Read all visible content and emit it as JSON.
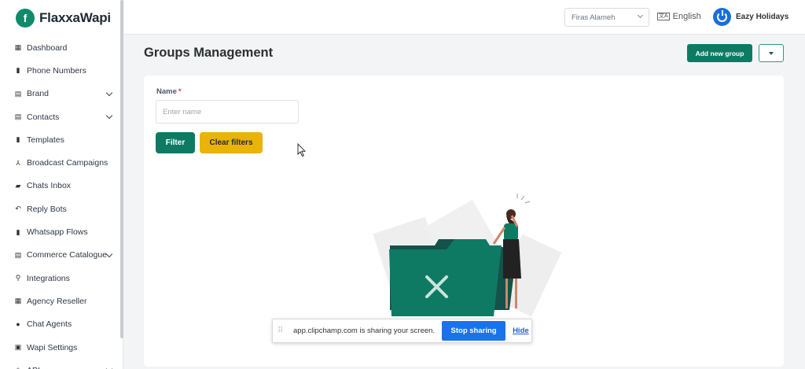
{
  "app": {
    "name": "FlaxxaWapi",
    "logo_letter": "f"
  },
  "sidebar": {
    "items": [
      {
        "label": "Dashboard",
        "icon": "dashboard-icon",
        "has_chevron": false
      },
      {
        "label": "Phone Numbers",
        "icon": "phone-numbers-icon",
        "has_chevron": false
      },
      {
        "label": "Brand",
        "icon": "brand-icon",
        "has_chevron": true
      },
      {
        "label": "Contacts",
        "icon": "contacts-icon",
        "has_chevron": true
      },
      {
        "label": "Templates",
        "icon": "templates-icon",
        "has_chevron": false
      },
      {
        "label": "Broadcast Campaigns",
        "icon": "broadcast-icon",
        "has_chevron": false
      },
      {
        "label": "Chats Inbox",
        "icon": "chats-icon",
        "has_chevron": false
      },
      {
        "label": "Reply Bots",
        "icon": "reply-icon",
        "has_chevron": false
      },
      {
        "label": "Whatsapp Flows",
        "icon": "flows-icon",
        "has_chevron": false
      },
      {
        "label": "Commerce Catalogue",
        "icon": "catalogue-icon",
        "has_chevron": true
      },
      {
        "label": "Integrations",
        "icon": "integrations-icon",
        "has_chevron": false
      },
      {
        "label": "Agency Reseller",
        "icon": "reseller-icon",
        "has_chevron": false
      },
      {
        "label": "Chat Agents",
        "icon": "agent-icon",
        "has_chevron": false
      },
      {
        "label": "Wapi Settings",
        "icon": "settings-icon",
        "has_chevron": false
      },
      {
        "label": "API",
        "icon": "api-icon",
        "has_chevron": true
      }
    ]
  },
  "topbar": {
    "user_select": "Firas Alameh",
    "language": "English",
    "company": "Eazy Holidays"
  },
  "main": {
    "title": "Groups Management",
    "add_button": "Add new group"
  },
  "filters": {
    "name_label": "Name",
    "required_mark": "*",
    "name_placeholder": "Enter name",
    "name_value": "",
    "filter_button": "Filter",
    "clear_button": "Clear filters"
  },
  "share_banner": {
    "message": "app.clipchamp.com is sharing your screen.",
    "stop_button": "Stop sharing",
    "hide_link": "Hide"
  },
  "colors": {
    "primary": "#0f7a64",
    "warning": "#eab308",
    "share_blue": "#1a73e8",
    "company_blue": "#1a6fd4"
  }
}
